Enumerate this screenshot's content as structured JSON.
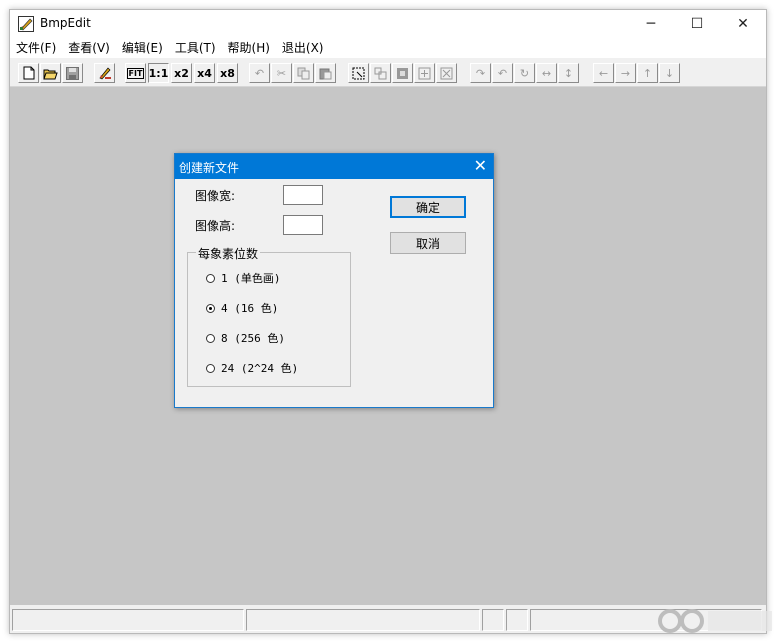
{
  "window": {
    "title": "BmpEdit",
    "controls": {
      "minimize": "─",
      "maximize": "☐",
      "close": "✕"
    }
  },
  "menu": [
    "文件(F)",
    "查看(V)",
    "编辑(E)",
    "工具(T)",
    "帮助(H)",
    "退出(X)"
  ],
  "toolbar": {
    "fit": "FIT",
    "zoom_1": "1:1",
    "zoom_2": "x2",
    "zoom_4": "x4",
    "zoom_8": "x8"
  },
  "dialog": {
    "title": "创建新文件",
    "close": "✕",
    "width_label": "图像宽:",
    "height_label": "图像高:",
    "width_value": "",
    "height_value": "",
    "ok": "确定",
    "cancel": "取消",
    "group_label": "每象素位数",
    "options": [
      {
        "label": "1 (单色画)",
        "checked": false
      },
      {
        "label": "4 (16 色)",
        "checked": true
      },
      {
        "label": "8 (256 色)",
        "checked": false
      },
      {
        "label": "24 (2^24 色)",
        "checked": false
      }
    ]
  },
  "colors": {
    "accent": "#0078d7",
    "client_bg": "#c6c6c6"
  }
}
